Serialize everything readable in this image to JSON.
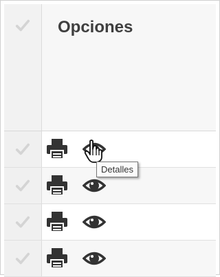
{
  "header": {
    "title": "Opciones"
  },
  "rows": [
    {
      "print_icon": "printer-icon",
      "view_icon": "eye-icon"
    },
    {
      "print_icon": "printer-icon",
      "view_icon": "eye-icon"
    },
    {
      "print_icon": "printer-icon",
      "view_icon": "eye-icon"
    },
    {
      "print_icon": "printer-icon",
      "view_icon": "eye-icon"
    }
  ],
  "tooltip": {
    "text": "Detalles"
  },
  "colors": {
    "icon": "#333333",
    "checkmark": "#d4d4d4",
    "header_text": "#3f3f3f"
  }
}
